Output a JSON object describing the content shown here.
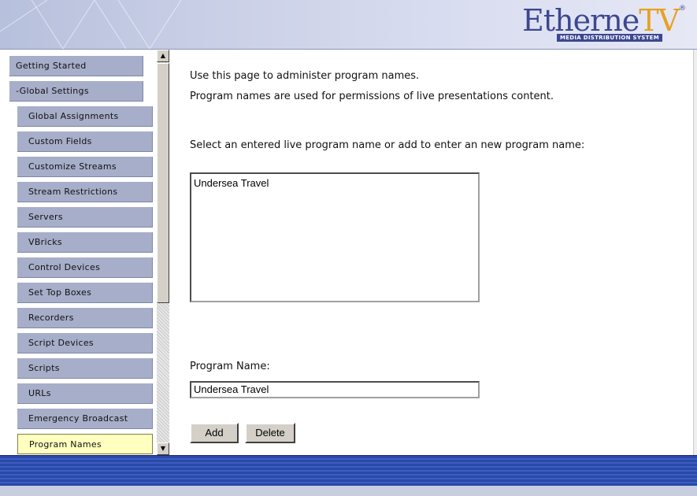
{
  "header": {
    "logo_main": "Etherne",
    "logo_accent": "TV",
    "logo_reg": "®",
    "logo_tagline": "MEDIA DISTRIBUTION SYSTEM"
  },
  "sidebar": {
    "items": [
      {
        "label": "Getting Started",
        "level": "top"
      },
      {
        "label": "-Global Settings",
        "level": "top"
      },
      {
        "label": "Global Assignments",
        "level": "sub"
      },
      {
        "label": "Custom Fields",
        "level": "sub"
      },
      {
        "label": "Customize Streams",
        "level": "sub"
      },
      {
        "label": "Stream Restrictions",
        "level": "sub"
      },
      {
        "label": "Servers",
        "level": "sub"
      },
      {
        "label": "VBricks",
        "level": "sub"
      },
      {
        "label": "Control Devices",
        "level": "sub"
      },
      {
        "label": "Set Top Boxes",
        "level": "sub"
      },
      {
        "label": "Recorders",
        "level": "sub"
      },
      {
        "label": "Script Devices",
        "level": "sub"
      },
      {
        "label": "Scripts",
        "level": "sub"
      },
      {
        "label": "URLs",
        "level": "sub"
      },
      {
        "label": "Emergency Broadcast",
        "level": "sub"
      },
      {
        "label": "Program Names",
        "level": "sub",
        "active": true
      }
    ],
    "scroll_up": "▲",
    "scroll_down": "▼"
  },
  "main": {
    "intro_line1": "Use this page to administer program names.",
    "intro_line2": "Program names are used for permissions of live presentations content.",
    "select_prompt": "Select an entered live program name or add to enter an new program name:",
    "program_list": [
      "Undersea Travel"
    ],
    "program_name_label": "Program Name:",
    "program_name_value": "Undersea Travel",
    "add_label": "Add",
    "delete_label": "Delete"
  }
}
